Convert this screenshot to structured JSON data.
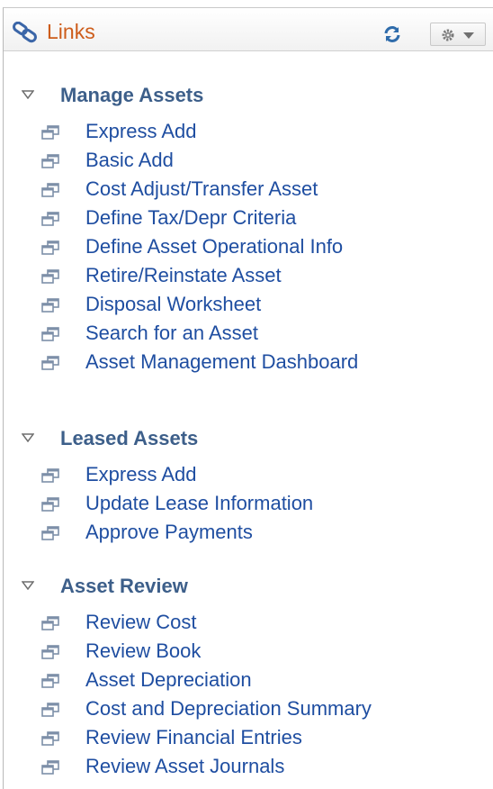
{
  "header": {
    "title": "Links",
    "icons": {
      "title": "links-chain-icon",
      "refresh": "refresh-icon",
      "options": "gear-dropdown-icon"
    }
  },
  "sections": [
    {
      "title": "Manage Assets",
      "links": [
        "Express Add",
        "Basic Add",
        "Cost Adjust/Transfer Asset",
        "Define Tax/Depr Criteria",
        "Define Asset Operational Info",
        "Retire/Reinstate Asset",
        "Disposal Worksheet",
        "Search for an Asset",
        "Asset Management Dashboard"
      ]
    },
    {
      "title": "Leased Assets",
      "links": [
        "Express Add",
        "Update Lease Information",
        "Approve Payments"
      ]
    },
    {
      "title": "Asset Review",
      "links": [
        "Review Cost",
        "Review Book",
        "Asset Depreciation",
        "Cost and Depreciation Summary",
        "Review Financial Entries",
        "Review Asset Journals"
      ]
    }
  ],
  "colors": {
    "title": "#cd5c1a",
    "section": "#3d5f8a",
    "link": "#1f4ea1"
  }
}
